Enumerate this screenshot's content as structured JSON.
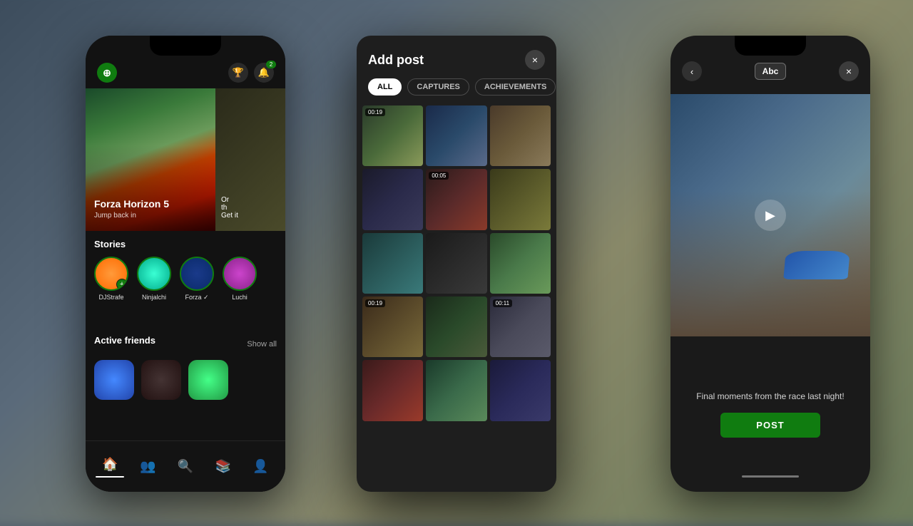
{
  "background": {
    "color": "#4a5a6a"
  },
  "left_phone": {
    "header": {
      "badge": "2"
    },
    "hero": {
      "title": "Forza Horizon 5",
      "subtitle": "Jump back in",
      "card2_line1": "Or",
      "card2_line2": "th",
      "card2_line3": "Get it"
    },
    "stories": {
      "section_title": "Stories",
      "items": [
        {
          "name": "DJStrafe",
          "color": "av-orange"
        },
        {
          "name": "Ninjalchi",
          "color": "av-teal"
        },
        {
          "name": "Forza ✓",
          "color": "av-forza"
        },
        {
          "name": "Luchi",
          "color": "av-purple"
        }
      ]
    },
    "friends": {
      "section_title": "Active friends",
      "show_all": "Show all",
      "items": [
        {
          "color": "av-bird"
        },
        {
          "color": "av-dark"
        },
        {
          "color": "av-green"
        }
      ]
    },
    "nav": {
      "items": [
        "🏠",
        "👥",
        "🔍",
        "📚",
        "👤"
      ]
    }
  },
  "center_modal": {
    "title": "Add post",
    "close": "×",
    "filters": [
      {
        "label": "ALL",
        "active": true
      },
      {
        "label": "CAPTURES",
        "active": false
      },
      {
        "label": "ACHIEVEMENTS",
        "active": false
      }
    ],
    "captures": [
      {
        "timer": "00:19",
        "class": "cap1"
      },
      {
        "timer": null,
        "class": "cap2"
      },
      {
        "timer": null,
        "class": "cap3"
      },
      {
        "timer": null,
        "class": "cap4"
      },
      {
        "timer": "00:05",
        "class": "cap5"
      },
      {
        "timer": null,
        "class": "cap6"
      },
      {
        "timer": null,
        "class": "cap7"
      },
      {
        "timer": null,
        "class": "cap8"
      },
      {
        "timer": null,
        "class": "cap9"
      },
      {
        "timer": "00:19",
        "class": "cap10"
      },
      {
        "timer": null,
        "class": "cap11"
      },
      {
        "timer": "00:11",
        "class": "cap12"
      },
      {
        "timer": null,
        "class": "cap13"
      },
      {
        "timer": null,
        "class": "cap14"
      },
      {
        "timer": null,
        "class": "cap15"
      }
    ]
  },
  "right_phone": {
    "back_label": "‹",
    "text_tool_label": "Abc",
    "close_label": "×",
    "caption": "Final moments from the race last night!",
    "post_button": "POST",
    "bottom_indicator_visible": true
  }
}
